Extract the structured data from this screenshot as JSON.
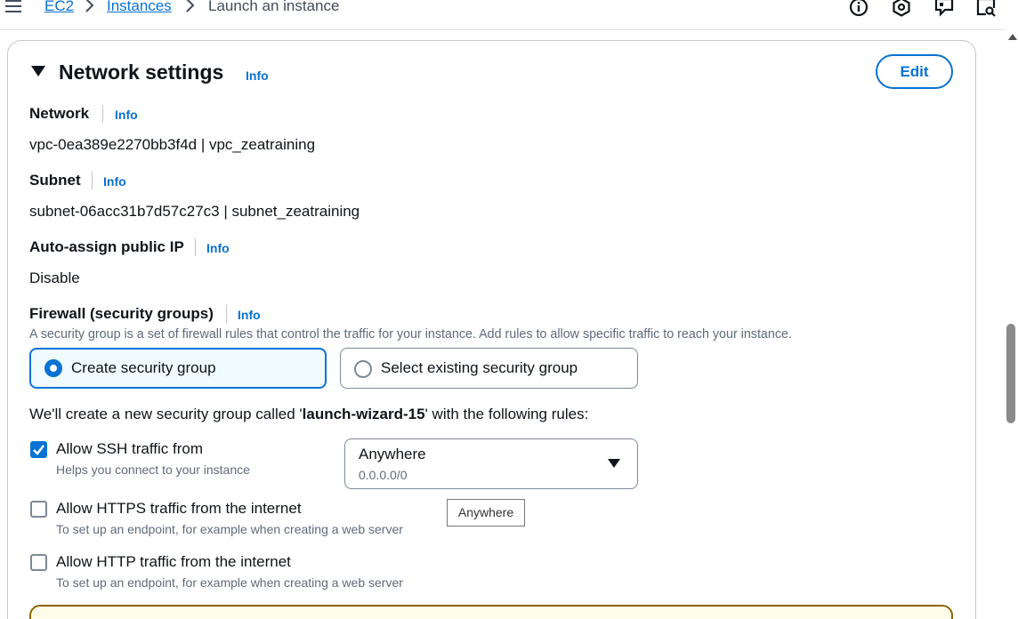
{
  "breadcrumb": {
    "items": [
      {
        "label": "EC2"
      },
      {
        "label": "Instances"
      },
      {
        "label": "Launch an instance"
      }
    ]
  },
  "top_icons": [
    "info-circle-icon",
    "settings-hexagon-icon",
    "feedback-chat-icon",
    "search-window-icon"
  ],
  "section": {
    "title": "Network settings",
    "info": "Info",
    "edit_label": "Edit"
  },
  "network": {
    "label": "Network",
    "info": "Info",
    "value": "vpc-0ea389e2270bb3f4d | vpc_zeatraining"
  },
  "subnet": {
    "label": "Subnet",
    "info": "Info",
    "value": "subnet-06acc31b7d57c27c3 | subnet_zeatraining"
  },
  "public_ip": {
    "label": "Auto-assign public IP",
    "info": "Info",
    "value": "Disable"
  },
  "firewall": {
    "label": "Firewall (security groups)",
    "info": "Info",
    "description": "A security group is a set of firewall rules that control the traffic for your instance. Add rules to allow specific traffic to reach your instance.",
    "options": [
      {
        "label": "Create security group",
        "selected": true
      },
      {
        "label": "Select existing security group",
        "selected": false
      }
    ],
    "intro_prefix": "We'll create a new security group called '",
    "group_name": "launch-wizard-15",
    "intro_suffix": "' with the following rules:"
  },
  "rules": [
    {
      "label": "Allow SSH traffic from",
      "description": "Helps you connect to your instance",
      "checked": true
    },
    {
      "label": "Allow HTTPS traffic from the internet",
      "description": "To set up an endpoint, for example when creating a web server",
      "checked": false
    },
    {
      "label": "Allow HTTP traffic from the internet",
      "description": "To set up an endpoint, for example when creating a web server",
      "checked": false
    }
  ],
  "ssh_source": {
    "value": "Anywhere",
    "sub": "0.0.0.0/0"
  },
  "tooltip": "Anywhere",
  "colors": {
    "accent": "#0972d3",
    "text": "#0f141a",
    "muted": "#5f6b7a",
    "border": "#7d8998",
    "warning_border": "#8d6605",
    "warning_bg": "#fffce9"
  }
}
